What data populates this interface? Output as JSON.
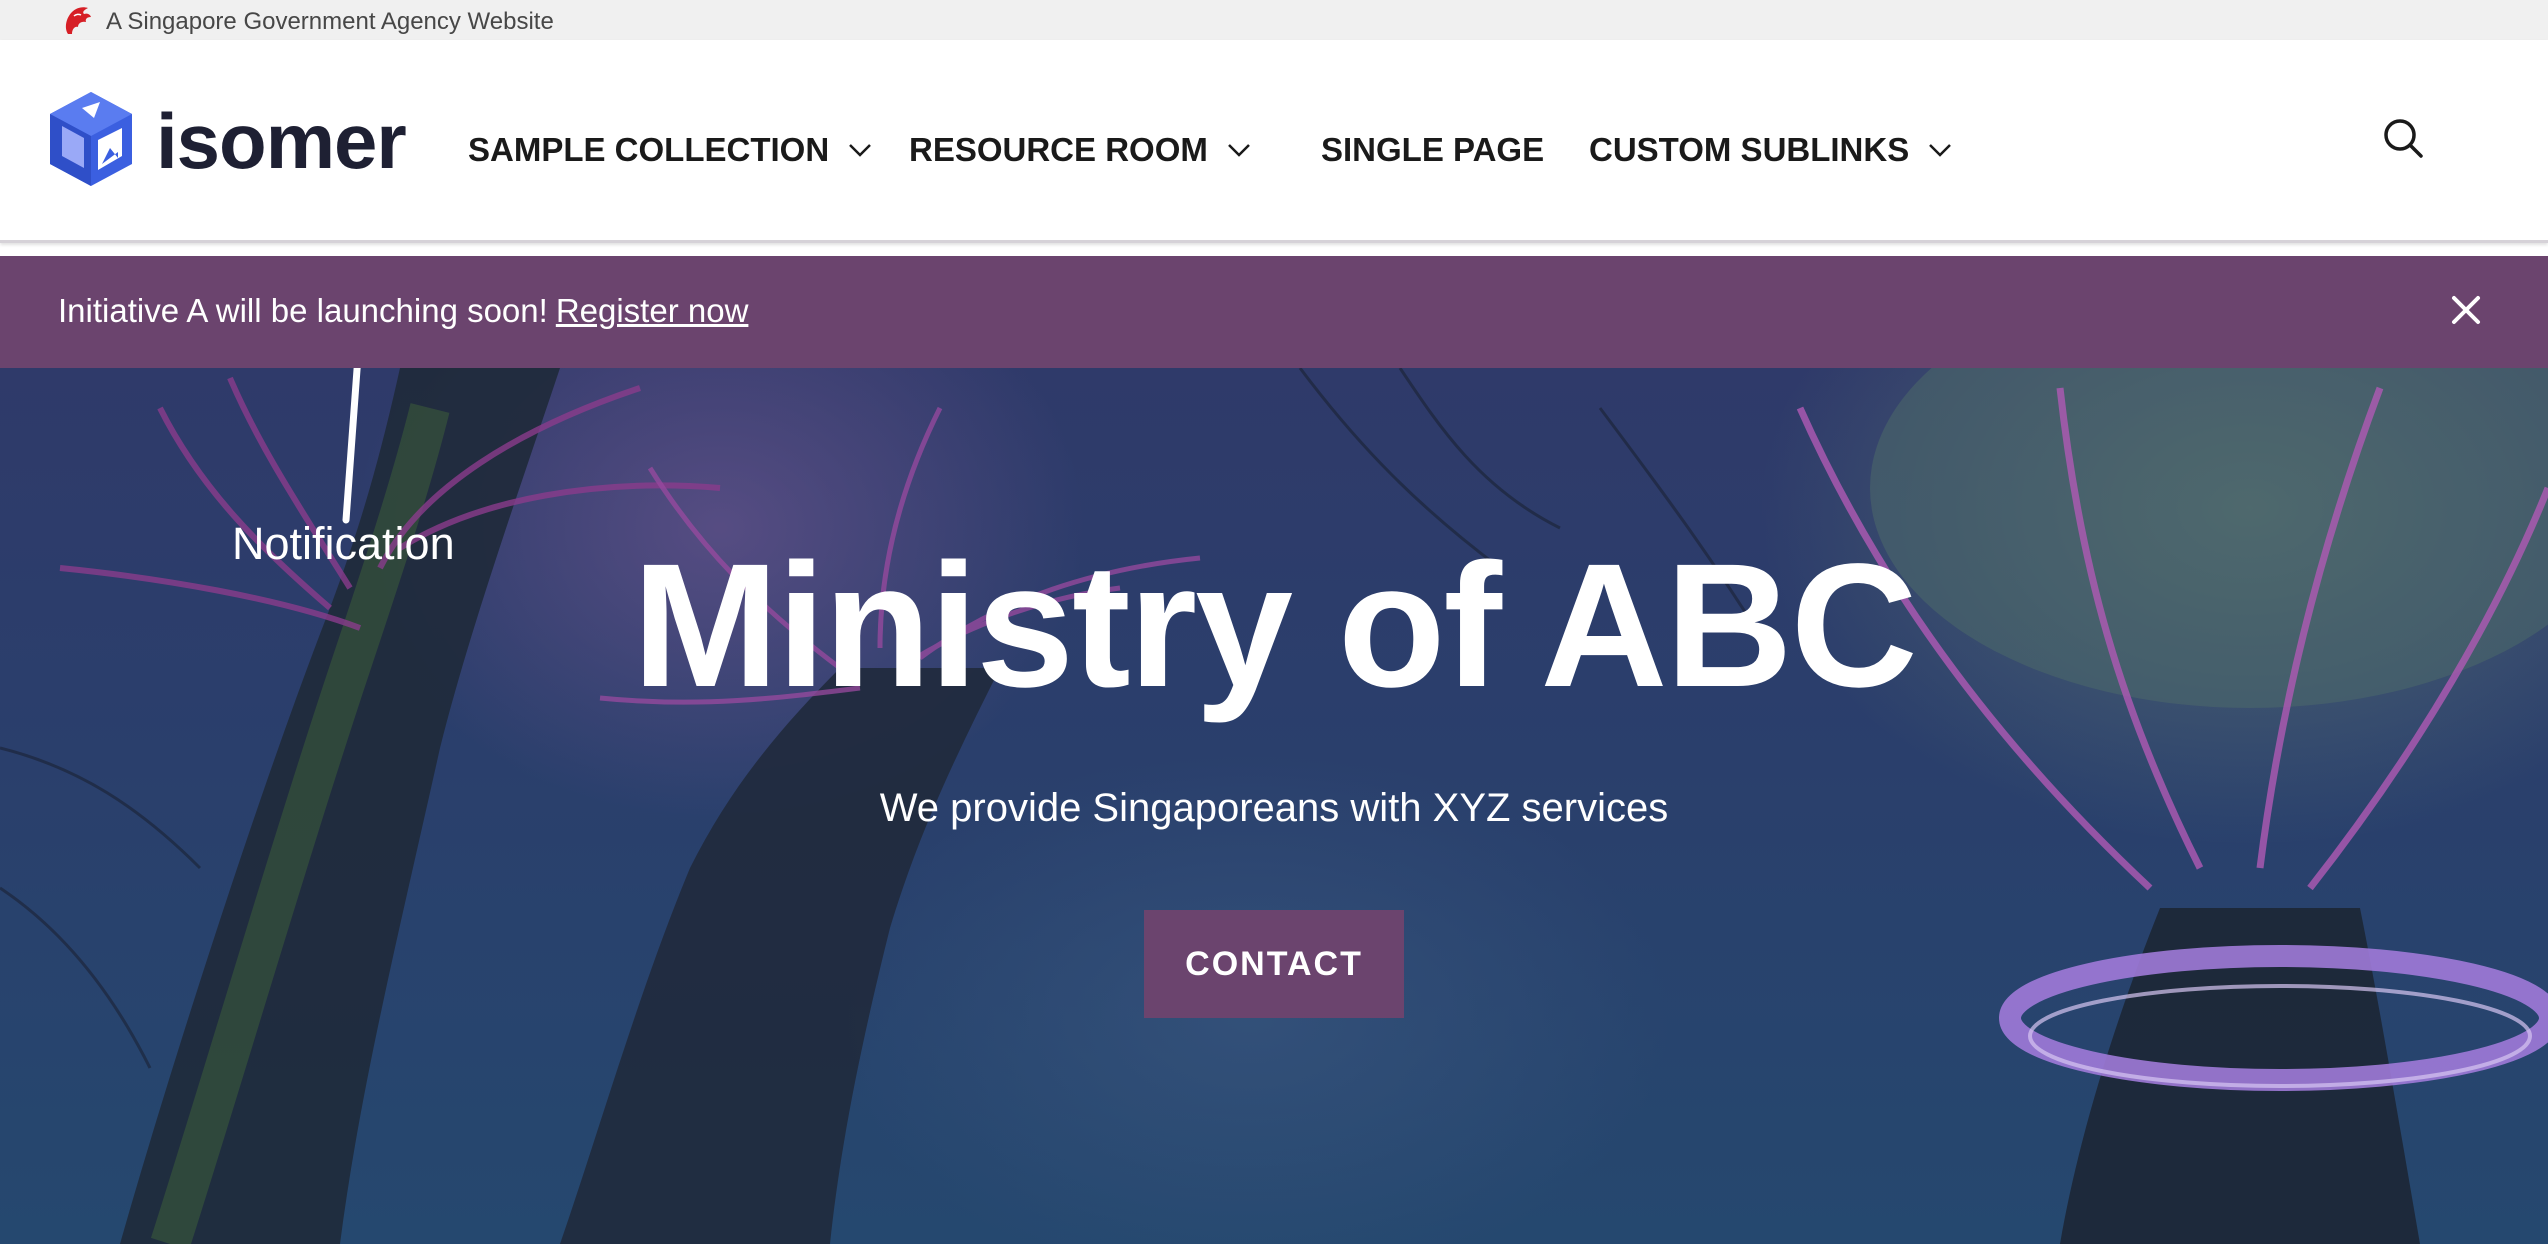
{
  "masthead": {
    "text": "A Singapore Government Agency Website",
    "icon": "lion-head-icon",
    "icon_color": "#d61f26"
  },
  "header": {
    "logo_text": "isomer",
    "logo_icon": "isomer-cube-icon",
    "logo_color": "#3b5fe0",
    "nav": [
      {
        "label": "SAMPLE COLLECTION",
        "has_dropdown": true
      },
      {
        "label": "RESOURCE ROOM",
        "has_dropdown": true
      },
      {
        "label": "SINGLE PAGE",
        "has_dropdown": false
      },
      {
        "label": "CUSTOM SUBLINKS",
        "has_dropdown": true
      }
    ],
    "search_icon": "search-icon"
  },
  "notification": {
    "text": "Initiative A will be launching soon!",
    "link_text": "Register now",
    "close_icon": "close-icon",
    "background": "#6b446e"
  },
  "annotation": {
    "label": "Notification"
  },
  "hero": {
    "title": "Ministry of ABC",
    "subtitle": "We provide Singaporeans with XYZ services",
    "button_label": "CONTACT",
    "button_color": "#6b446e"
  }
}
